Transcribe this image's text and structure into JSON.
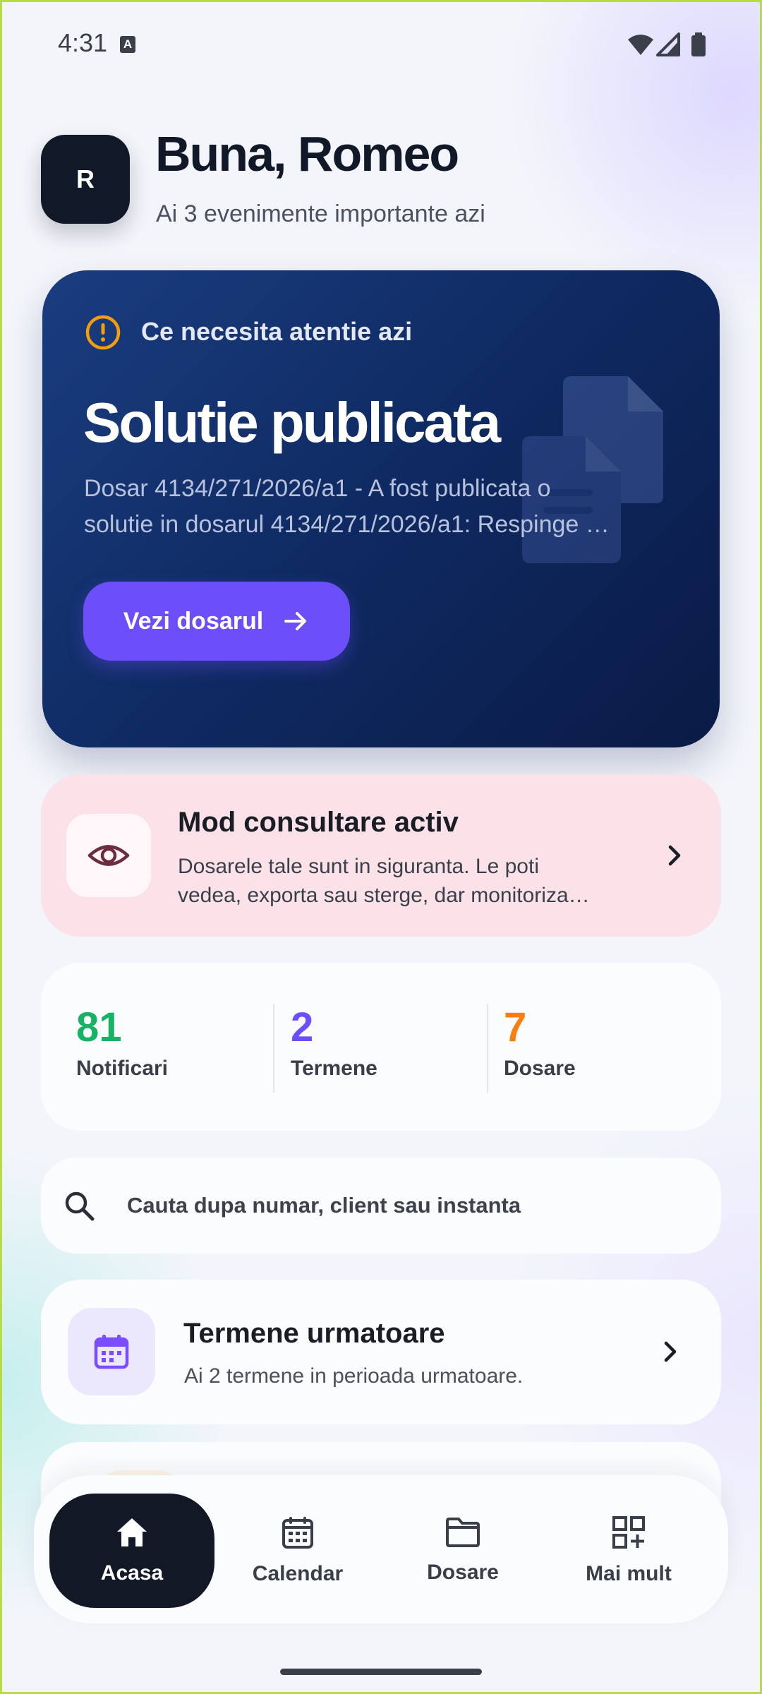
{
  "status_bar": {
    "time": "4:31",
    "notif_glyph": "A"
  },
  "greeting": {
    "avatar_initial": "R",
    "title": "Buna, Romeo",
    "subtitle": "Ai 3 evenimente importante azi"
  },
  "hero": {
    "kicker": "Ce necesita atentie azi",
    "title": "Solutie publicata",
    "text_line1": "Dosar 4134/271/2026/a1 - A fost publicata o",
    "text_line2": "solutie in dosarul 4134/271/2026/a1: Respinge …",
    "button_label": "Vezi dosarul",
    "colors": {
      "accent": "#6d4efb",
      "warning": "#f59e0b",
      "bg": "#0f2a62"
    }
  },
  "consult": {
    "title": "Mod consultare activ",
    "text_line1": "Dosarele tale sunt in siguranta. Le poti",
    "text_line2": "vedea, exporta sau sterge, dar monitoriza…"
  },
  "stats": [
    {
      "value": "81",
      "label": "Notificari",
      "color": "#16b364"
    },
    {
      "value": "2",
      "label": "Termene",
      "color": "#6d4efb"
    },
    {
      "value": "7",
      "label": "Dosare",
      "color": "#f97e10"
    }
  ],
  "search": {
    "placeholder": "Cauta dupa numar, client sau instanta"
  },
  "termene": {
    "title": "Termene urmatoare",
    "text": "Ai 2 termene in perioada urmatoare."
  },
  "nav": [
    {
      "label": "Acasa",
      "icon": "home-icon",
      "active": true
    },
    {
      "label": "Calendar",
      "icon": "calendar-icon",
      "active": false
    },
    {
      "label": "Dosare",
      "icon": "folder-icon",
      "active": false
    },
    {
      "label": "Mai mult",
      "icon": "apps-add-icon",
      "active": false
    }
  ]
}
